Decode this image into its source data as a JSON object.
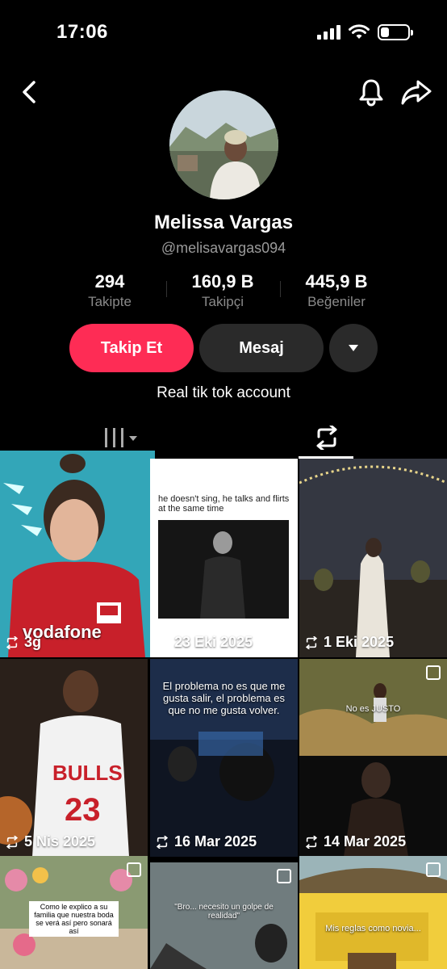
{
  "status_bar": {
    "time": "17:06"
  },
  "profile": {
    "name": "Melissa Vargas",
    "handle": "@melisavargas094",
    "bio": "Real tik tok account"
  },
  "stats": [
    {
      "value": "294",
      "label": "Takipte"
    },
    {
      "value": "160,9 B",
      "label": "Takipçi"
    },
    {
      "value": "445,9 B",
      "label": "Beğeniler"
    }
  ],
  "actions": {
    "follow_label": "Takip Et",
    "message_label": "Mesaj"
  },
  "videos": [
    {
      "badge": "3g",
      "caption": ""
    },
    {
      "badge": "23 Eki 2025",
      "caption": "he doesn't sing, he talks and flirts at the same time"
    },
    {
      "badge": "1 Eki 2025",
      "caption": ""
    },
    {
      "badge": "5 Nis 2025",
      "caption": ""
    },
    {
      "badge": "16 Mar 2025",
      "caption": "El problema no es que me gusta salir, el problema es que no me gusta volver."
    },
    {
      "badge": "14 Mar 2025",
      "caption": "No es JUSTO"
    },
    {
      "badge": "",
      "caption": "Como le explico a su familia que nuestra boda se verá así pero sonará así"
    },
    {
      "badge": "",
      "caption": "\"Bro... necesito un golpe de realidad\""
    },
    {
      "badge": "",
      "caption": "Mis reglas como novia..."
    }
  ],
  "colors": {
    "accent": "#fe2c55",
    "button_dark": "#2a2a2a"
  }
}
